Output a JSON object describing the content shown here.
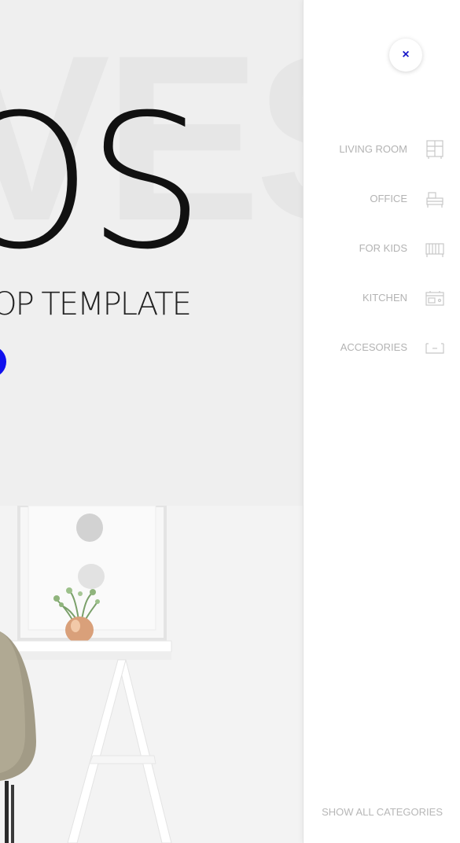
{
  "hero": {
    "ghost_text": "VEST",
    "title": "OS",
    "subtitle": "HOP TEMPLATE"
  },
  "menu": {
    "close_symbol": "×",
    "categories": [
      {
        "label": "LIVING ROOM",
        "icon": "shelf-icon"
      },
      {
        "label": "OFFICE",
        "icon": "desk-icon"
      },
      {
        "label": "FOR KIDS",
        "icon": "crib-icon"
      },
      {
        "label": "KITCHEN",
        "icon": "oven-icon"
      },
      {
        "label": "ACCESORIES",
        "icon": "box-icon"
      }
    ],
    "show_all_label": "SHOW ALL CATEGORIES"
  },
  "colors": {
    "accent": "#1010ee",
    "close_icon": "#1818c8",
    "menu_text": "#b3b3b3"
  }
}
